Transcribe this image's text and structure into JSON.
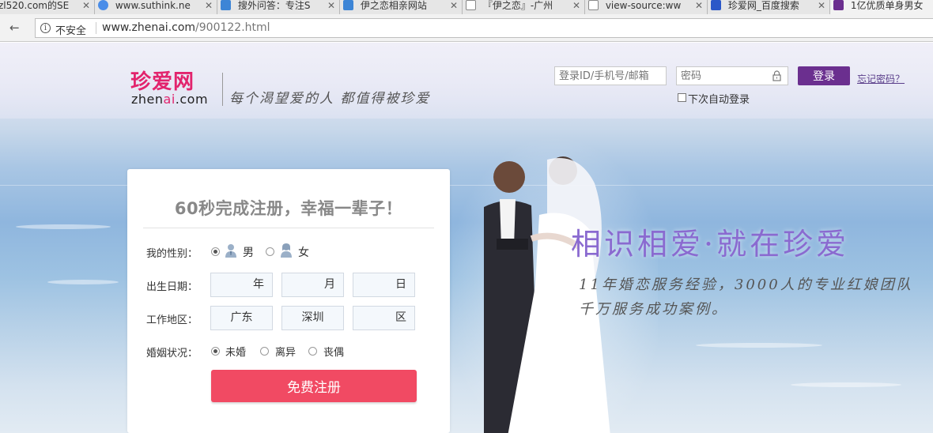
{
  "browser": {
    "tabs": [
      {
        "label": "zl520.com的SE",
        "icon_color": "#3b78d8",
        "icon": "page-icon"
      },
      {
        "label": "www.suthink.ne",
        "icon_color": "#4a8de8",
        "icon": "globe-icon"
      },
      {
        "label": "搜外问答：专注S",
        "icon_color": "#3d85d6",
        "icon": "s-logo-icon"
      },
      {
        "label": "伊之恋相亲网站",
        "icon_color": "#3d85d6",
        "icon": "s-logo-icon"
      },
      {
        "label": "『伊之恋』-广州",
        "icon_color": "#ffffff",
        "icon": "doc-icon"
      },
      {
        "label": "view-source:ww",
        "icon_color": "#ffffff",
        "icon": "doc-icon"
      },
      {
        "label": "珍爱网_百度搜索",
        "icon_color": "#2b58c8",
        "icon": "paw-icon"
      },
      {
        "label": "1亿优质单身男女",
        "icon_color": "#6b2f8f",
        "icon": "zhenai-icon"
      }
    ],
    "address": {
      "security_label": "不安全",
      "url_host": "www.zhenai.com",
      "url_path": "/900122.html"
    }
  },
  "header": {
    "logo_cn": "珍爱网",
    "logo_en_before": "zhen",
    "logo_en_ai": "ai",
    "logo_en_after": ".com",
    "slogan": "每个渴望爱的人 都值得被珍爱"
  },
  "login": {
    "username_placeholder": "登录ID/手机号/邮箱",
    "password_placeholder": "密码",
    "login_label": "登录",
    "forgot_label": "忘记密码？",
    "remember_label": "下次自动登录",
    "brand_color": "#6b2f8f"
  },
  "hero": {
    "title": "相识相爱·就在珍爱",
    "line1": "11年婚恋服务经验，3000人的专业红娘团队",
    "line2": "千万服务成功案例。"
  },
  "register": {
    "title": "60秒完成注册，幸福一辈子！",
    "gender_label": "我的性别：",
    "gender_male": "男",
    "gender_female": "女",
    "birth_label": "出生日期：",
    "birth_year": "年",
    "birth_month": "月",
    "birth_day": "日",
    "area_label": "工作地区：",
    "area_province": "广东",
    "area_city": "深圳",
    "area_district": "区",
    "marital_label": "婚姻状况：",
    "marital_single": "未婚",
    "marital_divorced": "离异",
    "marital_widowed": "丧偶",
    "submit_label": "免费注册",
    "submit_color": "#f14a63"
  }
}
